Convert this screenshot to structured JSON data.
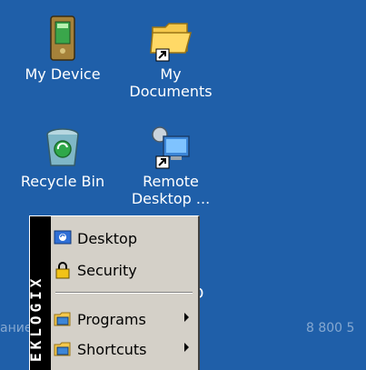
{
  "desktop": {
    "background_color": "#1f5fa9",
    "icons": [
      {
        "name": "my-device",
        "label": "My Device",
        "icon": "pda-device-icon"
      },
      {
        "name": "my-documents",
        "label_line1": "My",
        "label_line2": "Documents",
        "icon": "folder-shortcut-icon"
      },
      {
        "name": "recycle-bin",
        "label": "Recycle Bin",
        "icon": "recycle-bin-icon"
      },
      {
        "name": "remote-desktop",
        "label_line1": "Remote",
        "label_line2": "Desktop ...",
        "icon": "remote-desktop-shortcut-icon"
      }
    ]
  },
  "start_menu": {
    "band_text": "EKLOGIX",
    "items": [
      {
        "label": "Desktop",
        "icon": "desktop-icon",
        "submenu": false
      },
      {
        "label": "Security",
        "icon": "lock-icon",
        "submenu": false
      },
      {
        "label": "Programs",
        "icon": "programs-folder-icon",
        "submenu": true
      },
      {
        "label": "Shortcuts",
        "icon": "shortcuts-folder-icon",
        "submenu": true
      }
    ]
  },
  "overlay": {
    "left_text": "ание",
    "right_text": "8 800 5",
    "partial_label_char": "D"
  }
}
